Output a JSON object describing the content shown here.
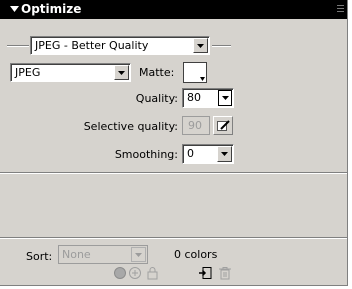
{
  "panel": {
    "title": "Optimize",
    "settings_preset": "JPEG - Better Quality",
    "format": "JPEG",
    "matte_label": "Matte:",
    "quality_label": "Quality:",
    "quality_value": "80",
    "selective_quality_label": "Selective quality:",
    "selective_quality_value": "90",
    "smoothing_label": "Smoothing:",
    "smoothing_value": "0",
    "sort_label": "Sort:",
    "sort_value": "None",
    "colors_count": "0 colors"
  },
  "icons": [
    "collapse-arrow-icon",
    "panel-grip-icon",
    "dropdown-arrow-icon",
    "matte-swatch-icon",
    "edit-selective-quality-icon",
    "palette-icons",
    "load-palette-icon",
    "delete-palette-icon"
  ],
  "colors": {
    "title_bg": "#000000",
    "panel_bg": "#d6d3ce",
    "disabled": "#9c9c9c"
  }
}
